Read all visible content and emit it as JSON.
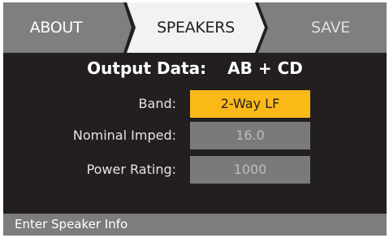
{
  "tabs": [
    {
      "label": "ABOUT",
      "state": "inactive"
    },
    {
      "label": "SPEAKERS",
      "state": "selected"
    },
    {
      "label": "SAVE",
      "state": "inactive"
    }
  ],
  "output": {
    "label": "Output Data:",
    "value": "AB + CD"
  },
  "fields": [
    {
      "label": "Band:",
      "value": "2-Way LF",
      "state": "active"
    },
    {
      "label": "Nominal Imped:",
      "value": "16.0",
      "state": "inactive"
    },
    {
      "label": "Power Rating:",
      "value": "1000",
      "state": "inactive"
    }
  ],
  "status": "Enter Speaker Info",
  "colors": {
    "background": "#231f20",
    "tab_inactive": "#7f7f7f",
    "tab_selected": "#f2f2f2",
    "accent": "#fbb918",
    "field_inactive": "#7a7a7a"
  }
}
